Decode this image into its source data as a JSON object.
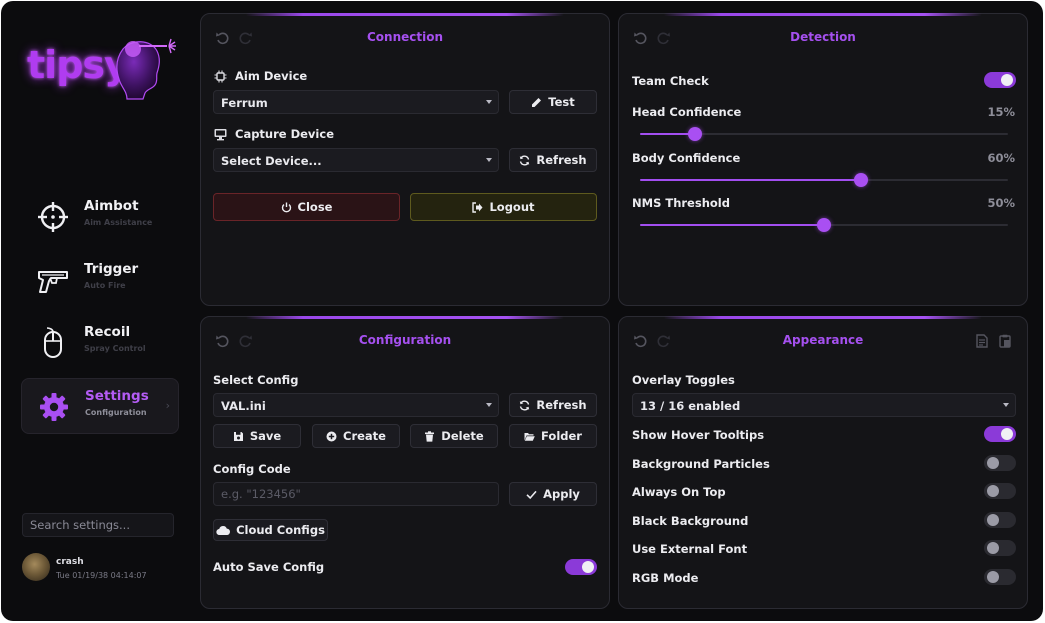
{
  "app": {
    "logo_text": "tipsy"
  },
  "sidebar": {
    "items": [
      {
        "title": "Aimbot",
        "subtitle": "Aim Assistance"
      },
      {
        "title": "Trigger",
        "subtitle": "Auto Fire"
      },
      {
        "title": "Recoil",
        "subtitle": "Spray Control"
      },
      {
        "title": "Settings",
        "subtitle": "Configuration",
        "chevron": "›"
      }
    ],
    "search_placeholder": "Search settings...",
    "user": {
      "name": "crash",
      "timestamp": "Tue 01/19/38 04:14:07"
    }
  },
  "connection": {
    "title": "Connection",
    "aim_device": {
      "label": "Aim Device",
      "value": "Ferrum",
      "test_label": "Test"
    },
    "capture_device": {
      "label": "Capture Device",
      "value": "Select Device...",
      "refresh_label": "Refresh"
    },
    "close_label": "Close",
    "logout_label": "Logout"
  },
  "detection": {
    "title": "Detection",
    "team_check": {
      "label": "Team Check",
      "on": true
    },
    "sliders": [
      {
        "label": "Head Confidence",
        "value_text": "15%",
        "value": 0.15
      },
      {
        "label": "Body Confidence",
        "value_text": "60%",
        "value": 0.6
      },
      {
        "label": "NMS Threshold",
        "value_text": "50%",
        "value": 0.5
      }
    ]
  },
  "configuration": {
    "title": "Configuration",
    "select_config_label": "Select Config",
    "selected_config": "VAL.ini",
    "refresh_label": "Refresh",
    "save_label": "Save",
    "create_label": "Create",
    "delete_label": "Delete",
    "folder_label": "Folder",
    "config_code_label": "Config Code",
    "config_code_placeholder": "e.g. \"123456\"",
    "apply_label": "Apply",
    "cloud_configs_label": "Cloud Configs",
    "auto_save": {
      "label": "Auto Save Config",
      "on": true
    }
  },
  "appearance": {
    "title": "Appearance",
    "overlay_toggles_label": "Overlay Toggles",
    "overlay_toggles_value": "13 / 16 enabled",
    "toggles": [
      {
        "label": "Show Hover Tooltips",
        "on": true
      },
      {
        "label": "Background Particles",
        "on": false
      },
      {
        "label": "Always On Top",
        "on": false
      },
      {
        "label": "Black Background",
        "on": false
      },
      {
        "label": "Use External Font",
        "on": false
      },
      {
        "label": "RGB Mode",
        "on": false
      }
    ]
  },
  "colors": {
    "accent": "#a550ef",
    "toggle_on": "#8b3ad8",
    "close_bg": "#2a1316",
    "logout_bg": "#24230f"
  }
}
